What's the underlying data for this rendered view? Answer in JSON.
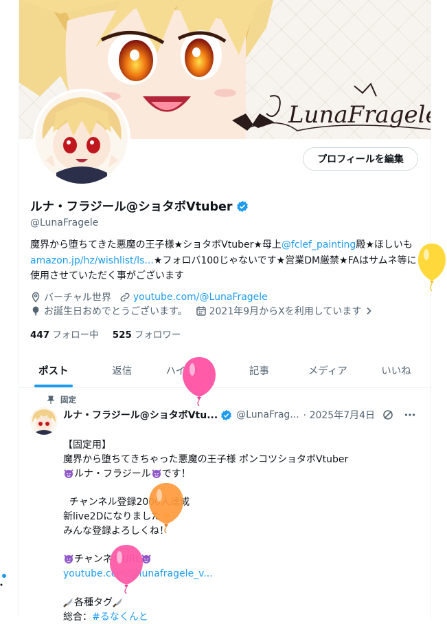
{
  "profile": {
    "display_name": "ルナ・フラジール@ショタボVtuber",
    "handle": "@LunaFragele",
    "edit_button": "プロフィールを編集",
    "banner_signature": "LunaFragele",
    "bio": {
      "part1": "魔界から堕ちてきた悪魔の王子様★ショタボVtuber★母上",
      "link1": "@fclef_painting",
      "part2": "殿★ほしいも",
      "link2": "amazon.jp/hz/wishlist/ls...",
      "part3": "★フォロバ100じゃないです★営業DM厳禁★FAはサムネ等に使用させていただく事がございます"
    },
    "location": "バーチャル世界",
    "website": "youtube.com/@LunaFragele",
    "birthday": "お誕生日おめでとうございます。",
    "joined": "2021年9月からXを利用しています",
    "following_count": "447",
    "following_label": "フォロー中",
    "followers_count": "525",
    "followers_label": "フォロワー"
  },
  "tabs": [
    {
      "label": "ポスト"
    },
    {
      "label": "返信"
    },
    {
      "label": "ハイライト"
    },
    {
      "label": "記事"
    },
    {
      "label": "メディア"
    },
    {
      "label": "いいね"
    }
  ],
  "pinned_tweet": {
    "pinned_label": "固定",
    "author_name": "ルナ・フラジール@ショタボVtu...",
    "author_handle": "@LunaFrag...",
    "date": "· 2025年7月4日",
    "line1": "【固定用】",
    "line2": "魔界から堕ちてきちゃった悪魔の王子様 ポンコツショタボVtuber",
    "line3": "ルナ・フラジール",
    "line3_end": "です！",
    "line4": "  チャンネル登録2000人達成",
    "line5": "新live2Dになりました",
    "line6": "みんな登録よろしくね！",
    "line7": "チャンネルURL",
    "line8_link": "youtube.com/@lunafragele_v...",
    "line9": "各種タグ",
    "line10_label": "総合：",
    "line10_link": "#るなくんと"
  },
  "colors": {
    "accent": "#1d9bf0",
    "muted": "#536471",
    "balloon_yellow": "#ffd93b",
    "balloon_pink": "#ff5ba8",
    "balloon_orange": "#ff9a3c"
  }
}
